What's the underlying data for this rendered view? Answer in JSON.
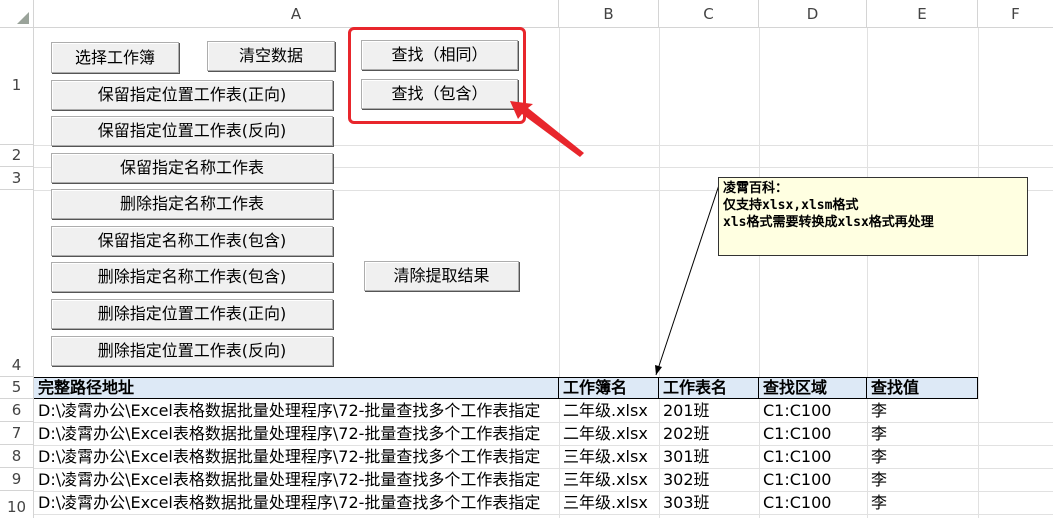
{
  "columns": [
    "A",
    "B",
    "C",
    "D",
    "E",
    "F"
  ],
  "rows": [
    "1",
    "2",
    "3",
    "4",
    "5",
    "6",
    "7",
    "8",
    "9",
    "10"
  ],
  "buttons": {
    "select_workbook": "选择工作簿",
    "clear_data": "清空数据",
    "find_same": "查找（相同）",
    "find_contains": "查找（包含）",
    "keep_pos_forward": "保留指定位置工作表(正向)",
    "keep_pos_reverse": "保留指定位置工作表(反向)",
    "keep_name": "保留指定名称工作表",
    "delete_name": "删除指定名称工作表",
    "keep_name_contains": "保留指定名称工作表(包含)",
    "delete_name_contains": "删除指定名称工作表(包含)",
    "clear_results": "清除提取结果",
    "delete_pos_forward": "删除指定位置工作表(正向)",
    "delete_pos_reverse": "删除指定位置工作表(反向)"
  },
  "comment": {
    "line1": "凌霄百科：",
    "line2": "仅支持xlsx,xlsm格式",
    "line3": "xls格式需要转换成xlsx格式再处理"
  },
  "table": {
    "headers": [
      "完整路径地址",
      "工作簿名",
      "工作表名",
      "查找区域",
      "查找值"
    ],
    "rows": [
      [
        "D:\\凌霄办公\\Excel表格数据批量处理程序\\72-批量查找多个工作表指定",
        "二年级.xlsx",
        "201班",
        "C1:C100",
        "李"
      ],
      [
        "D:\\凌霄办公\\Excel表格数据批量处理程序\\72-批量查找多个工作表指定",
        "二年级.xlsx",
        "202班",
        "C1:C100",
        "李"
      ],
      [
        "D:\\凌霄办公\\Excel表格数据批量处理程序\\72-批量查找多个工作表指定",
        "三年级.xlsx",
        "301班",
        "C1:C100",
        "李"
      ],
      [
        "D:\\凌霄办公\\Excel表格数据批量处理程序\\72-批量查找多个工作表指定",
        "三年级.xlsx",
        "302班",
        "C1:C100",
        "李"
      ],
      [
        "D:\\凌霄办公\\Excel表格数据批量处理程序\\72-批量查找多个工作表指定",
        "三年级.xlsx",
        "303班",
        "C1:C100",
        "李"
      ]
    ]
  },
  "colors": {
    "highlight": "#e8262c",
    "header_fill": "#dde9f6",
    "comment_fill": "#ffffe1"
  }
}
